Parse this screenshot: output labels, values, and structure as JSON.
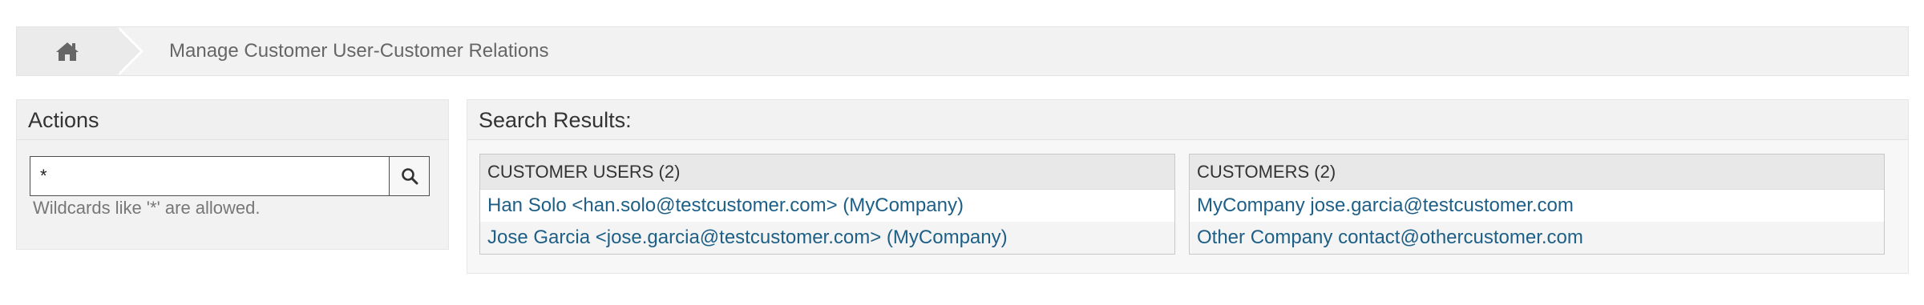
{
  "breadcrumb": {
    "home_icon": "home-icon",
    "title": "Manage Customer User-Customer Relations"
  },
  "actions": {
    "title": "Actions",
    "search_value": "*",
    "search_icon": "search-icon",
    "hint": "Wildcards like '*' are allowed."
  },
  "results": {
    "title": "Search Results:",
    "customer_users": {
      "header": "CUSTOMER USERS (2)",
      "items": [
        "Han Solo <han.solo@testcustomer.com> (MyCompany)",
        "Jose Garcia <jose.garcia@testcustomer.com> (MyCompany)"
      ]
    },
    "customers": {
      "header": "CUSTOMERS (2)",
      "items": [
        "MyCompany jose.garcia@testcustomer.com",
        "Other Company contact@othercustomer.com"
      ]
    }
  },
  "colors": {
    "link": "#1d5f87",
    "panel_bg": "#f2f2f2",
    "text": "#333333"
  }
}
